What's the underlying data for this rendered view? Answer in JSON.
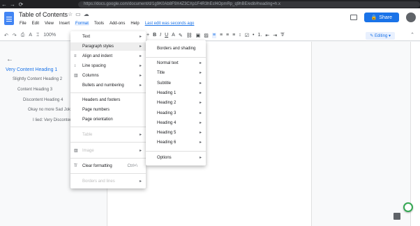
{
  "browser": {
    "url": "https://docs.google.com/document/d/1g9K0Ab8F9X4Z3CXp1F4R3hEsf4OpmRp_q9hBE/edit#heading=h.x"
  },
  "doc": {
    "title": "Table of Contents",
    "menus": [
      "File",
      "Edit",
      "View",
      "Insert",
      "Format",
      "Tools",
      "Add-ons",
      "Help"
    ],
    "last_edit": "Last edit was seconds ago",
    "share_label": "Share",
    "zoom": "100%",
    "mode": "Editing"
  },
  "outline": {
    "items": [
      {
        "label": "Very Content Heading 1",
        "level": 1
      },
      {
        "label": "Slightly Content Heading 2",
        "level": 2
      },
      {
        "label": "Content Heading 3",
        "level": 3
      },
      {
        "label": "Discontent Heading 4",
        "level": 4
      },
      {
        "label": "Okay no more Sad Jokes",
        "level": 5
      },
      {
        "label": "I lied: Very Discontent",
        "level": 6
      }
    ]
  },
  "format_menu": {
    "items": [
      {
        "label": "Text",
        "submenu": true
      },
      {
        "label": "Paragraph styles",
        "submenu": true
      },
      {
        "label": "Align and indent",
        "submenu": true
      },
      {
        "label": "Line spacing",
        "submenu": true
      },
      {
        "label": "Columns",
        "submenu": true
      },
      {
        "label": "Bullets and numbering",
        "submenu": true
      },
      {
        "label": "Headers and footers"
      },
      {
        "label": "Page numbers"
      },
      {
        "label": "Page orientation"
      },
      {
        "label": "Table",
        "submenu": true,
        "disabled": true
      },
      {
        "label": "Image",
        "submenu": true,
        "disabled": true
      },
      {
        "label": "Clear formatting",
        "shortcut": "Ctrl+\\"
      },
      {
        "label": "Borders and lines",
        "submenu": true,
        "disabled": true
      }
    ]
  },
  "paragraph_menu": {
    "items": [
      {
        "label": "Borders and shading"
      },
      {
        "label": "Normal text"
      },
      {
        "label": "Title"
      },
      {
        "label": "Subtitle"
      },
      {
        "label": "Heading 1"
      },
      {
        "label": "Heading 2"
      },
      {
        "label": "Heading 3"
      },
      {
        "label": "Heading 4"
      },
      {
        "label": "Heading 5"
      },
      {
        "label": "Heading 6"
      },
      {
        "label": "Options"
      }
    ]
  },
  "colors": {
    "accent": "#1a73e8",
    "docs_blue": "#4285f4"
  }
}
